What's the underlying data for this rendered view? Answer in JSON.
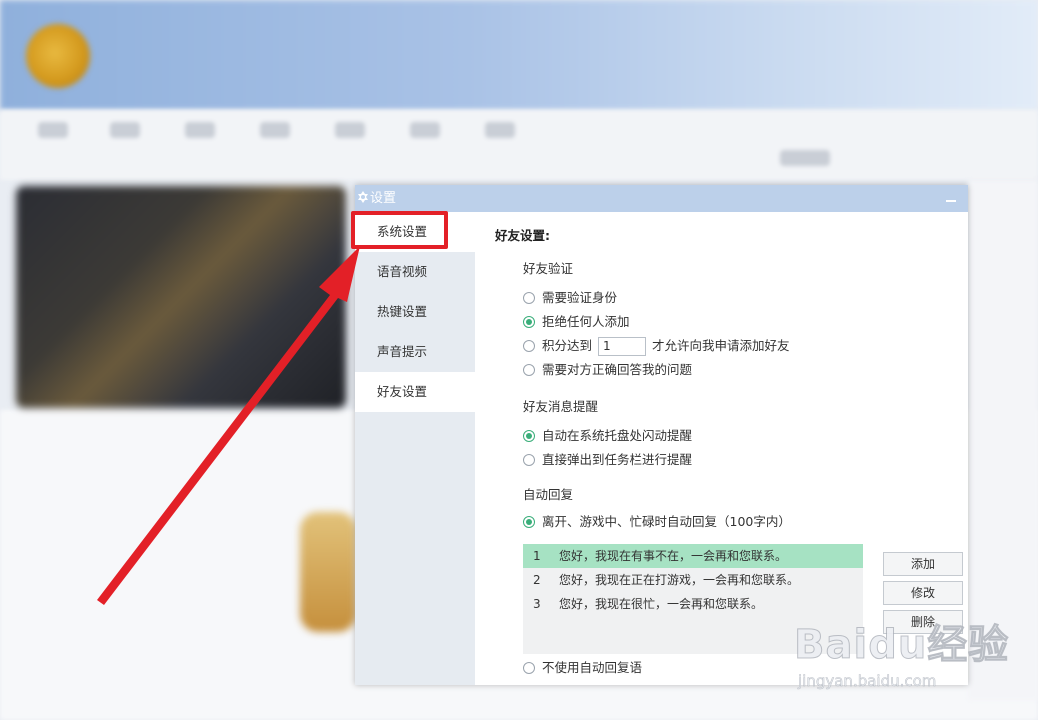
{
  "dialog": {
    "title": "设置"
  },
  "sidebar": {
    "items": [
      {
        "label": "系统设置"
      },
      {
        "label": "语音视频"
      },
      {
        "label": "热键设置"
      },
      {
        "label": "声音提示"
      },
      {
        "label": "好友设置"
      }
    ]
  },
  "friend_settings": {
    "section_title": "好友设置:",
    "verification": {
      "title": "好友验证",
      "options": [
        {
          "label": "需要验证身份",
          "selected": false
        },
        {
          "label": "拒绝任何人添加",
          "selected": true
        },
        {
          "label": "积分达到",
          "selected": false
        },
        {
          "label": "需要对方正确回答我的问题",
          "selected": false
        }
      ],
      "score_value": "1",
      "score_suffix": "才允许向我申请添加好友"
    },
    "message_alert": {
      "title": "好友消息提醒",
      "options": [
        {
          "label": "自动在系统托盘处闪动提醒",
          "selected": true
        },
        {
          "label": "直接弹出到任务栏进行提醒",
          "selected": false
        }
      ]
    },
    "auto_reply": {
      "title": "自动回复",
      "enable_label": "离开、游戏中、忙碌时自动回复（100字内）",
      "disable_label": "不使用自动回复语",
      "replies": [
        {
          "num": "1",
          "text": "您好，我现在有事不在，一会再和您联系。"
        },
        {
          "num": "2",
          "text": "您好，我现在正在打游戏，一会再和您联系。"
        },
        {
          "num": "3",
          "text": "您好，我现在很忙，一会再和您联系。"
        }
      ],
      "buttons": {
        "add": "添加",
        "edit": "修改",
        "delete": "删除"
      }
    }
  },
  "watermark": {
    "brand": "Baidu经验",
    "url": "jingyan.baidu.com"
  },
  "colors": {
    "accent_green": "#3aae7a",
    "selected_row": "#a6e2c3",
    "annotation_red": "#e32027",
    "titlebar": "#bcd0ea"
  }
}
